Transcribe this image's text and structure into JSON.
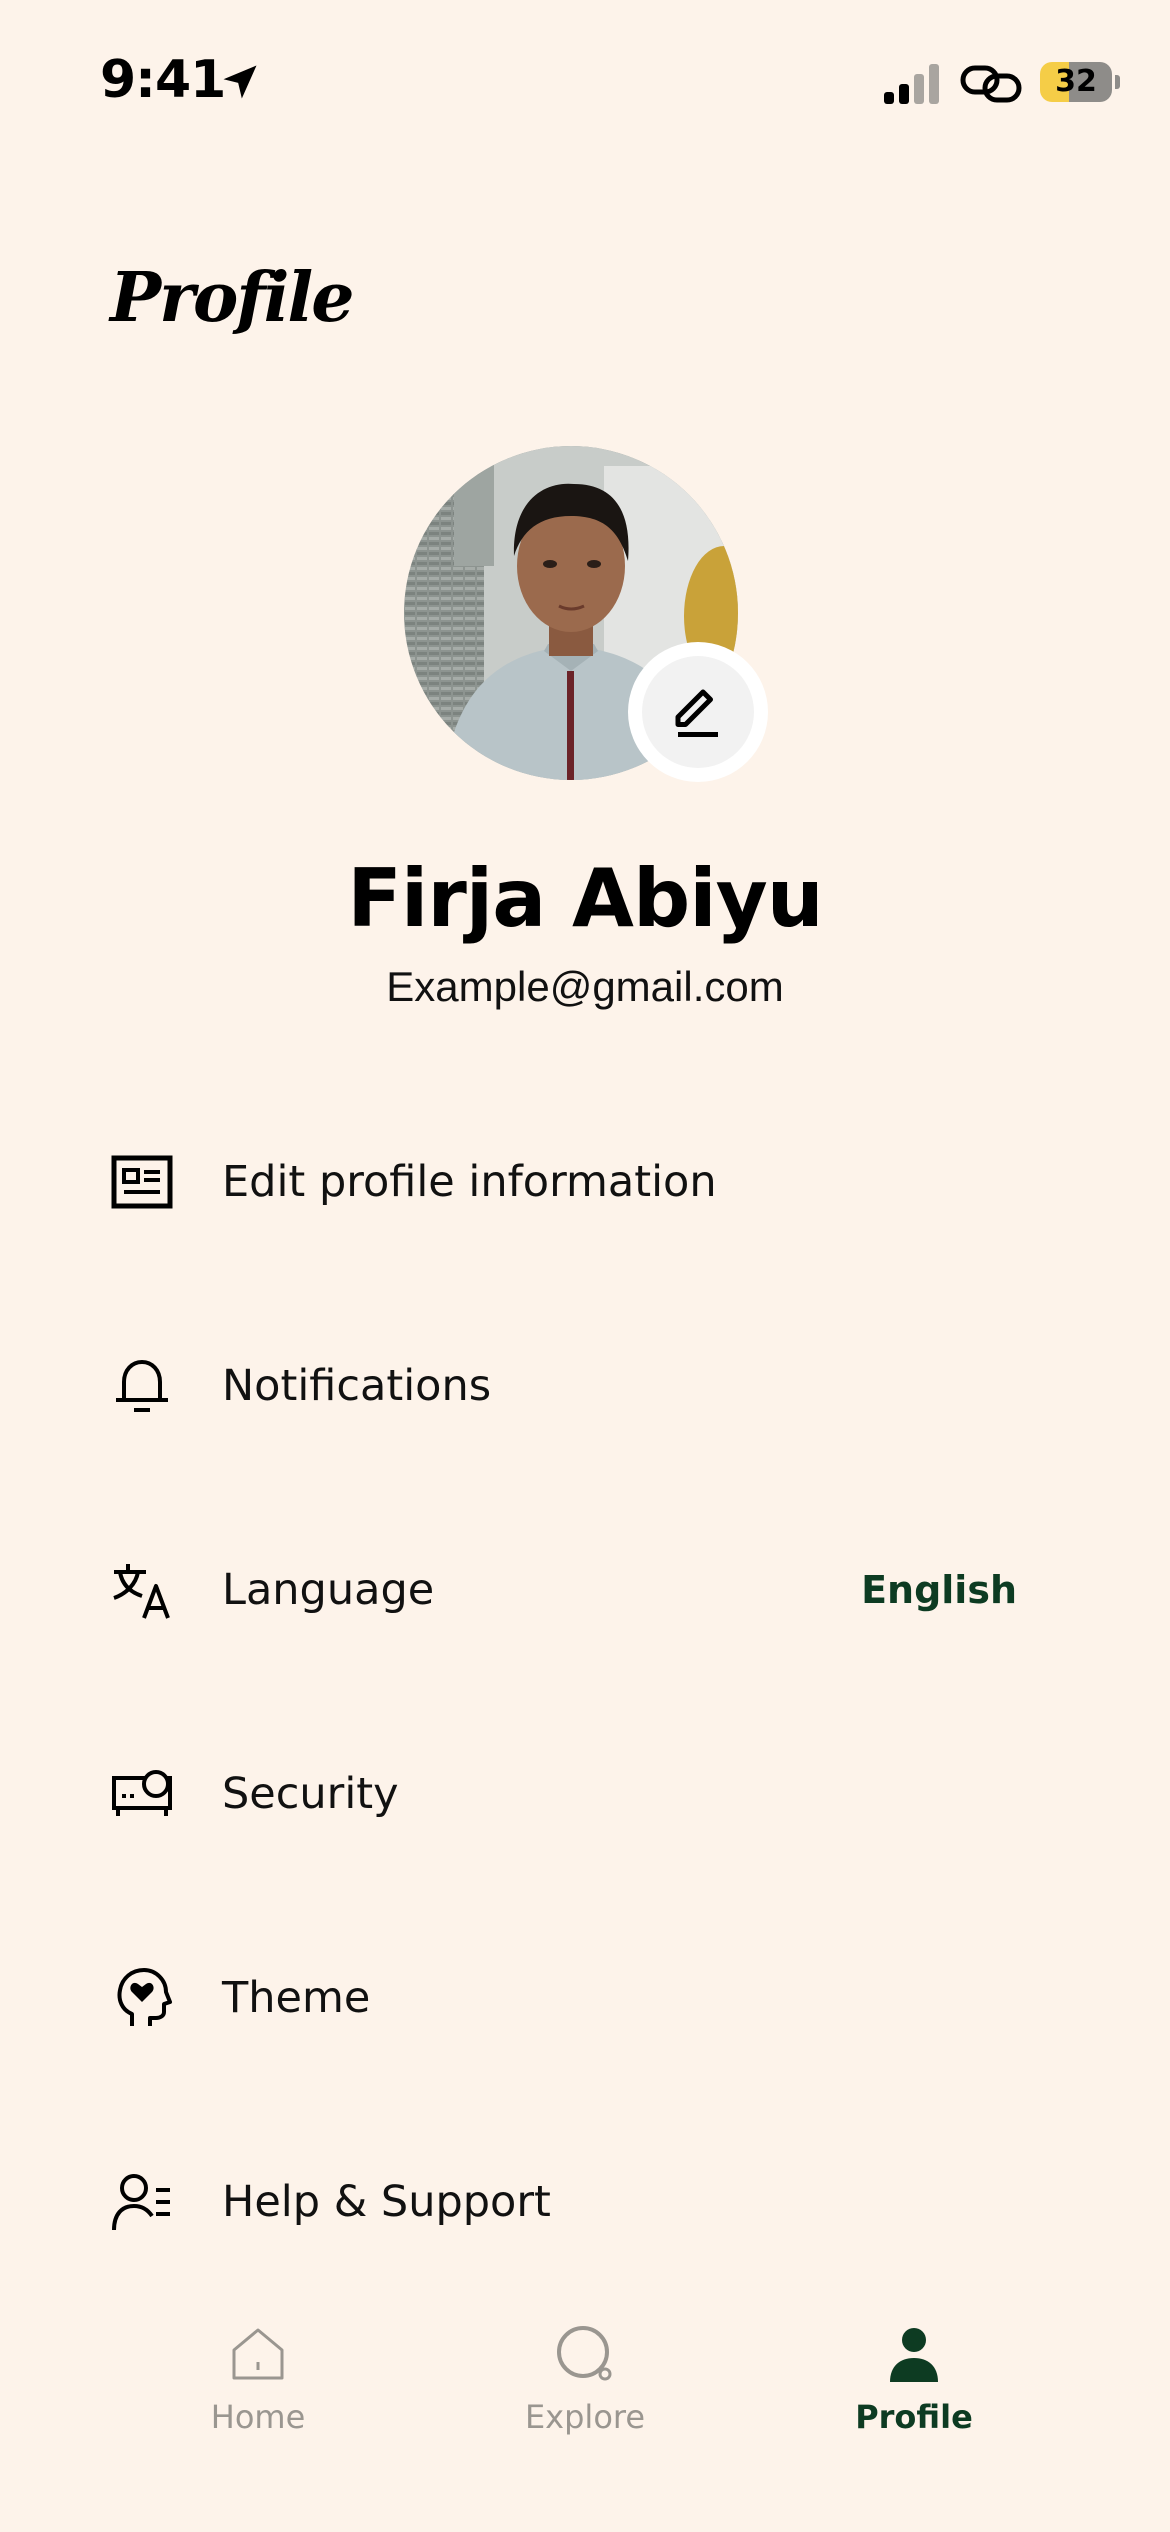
{
  "status_bar": {
    "time": "9:41",
    "battery": "32"
  },
  "page": {
    "title": "Profile"
  },
  "user": {
    "name": "Firja Abiyu",
    "email": "Example@gmail.com"
  },
  "menu": {
    "items": [
      {
        "label": "Edit profile information",
        "icon": "id-card-icon"
      },
      {
        "label": "Notifications",
        "icon": "bell-icon"
      },
      {
        "label": "Language",
        "icon": "translate-icon",
        "value": "English"
      },
      {
        "label": "Security",
        "icon": "security-icon"
      },
      {
        "label": "Theme",
        "icon": "theme-head-icon"
      },
      {
        "label": "Help & Support",
        "icon": "help-support-icon"
      }
    ]
  },
  "tab_bar": {
    "tabs": [
      {
        "label": "Home",
        "icon": "home-icon",
        "active": false
      },
      {
        "label": "Explore",
        "icon": "explore-icon",
        "active": false
      },
      {
        "label": "Profile",
        "icon": "profile-icon",
        "active": true
      }
    ]
  },
  "colors": {
    "background": "#FDF3EA",
    "accent": "#0D3B22",
    "inactive_tab": "#9A9690",
    "battery": "#F5CD47"
  }
}
